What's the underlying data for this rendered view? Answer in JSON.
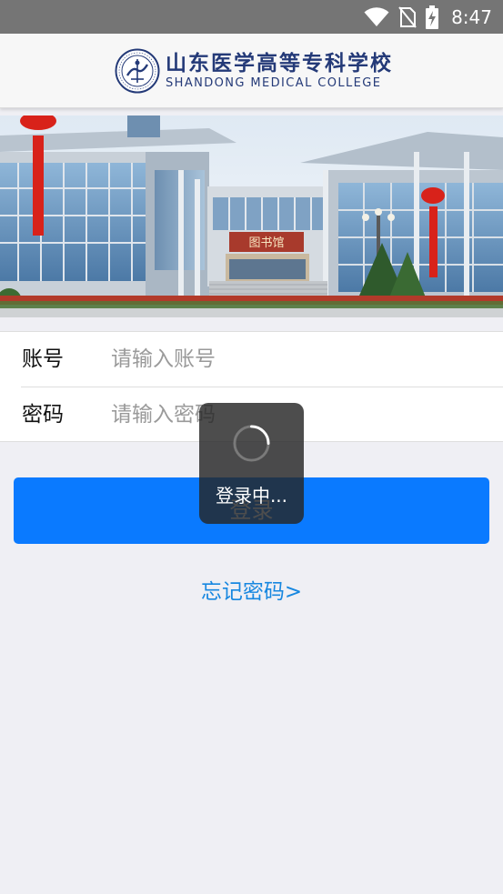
{
  "status_bar": {
    "time": "8:47",
    "icons": [
      "wifi-icon",
      "no-sim-icon",
      "battery-charging-icon"
    ]
  },
  "header": {
    "school_name_cn": "山东医学高等专科学校",
    "school_name_en": "SHANDONG MEDICAL COLLEGE",
    "logo": "school-seal-icon"
  },
  "banner": {
    "image": "campus-library-building",
    "sign_text": "图书馆"
  },
  "form": {
    "account": {
      "label": "账号",
      "placeholder": "请输入账号",
      "value": ""
    },
    "password": {
      "label": "密码",
      "placeholder": "请输入密码",
      "value": ""
    }
  },
  "login_button": {
    "label": "登录"
  },
  "forgot_link": {
    "label": "忘记密码>"
  },
  "loading_toast": {
    "text": "登录中..."
  },
  "colors": {
    "primary_button": "#0a7aff",
    "link": "#1787e0",
    "status_bar": "#757575",
    "page_bg": "#efeff4",
    "brand_navy": "#243a78"
  }
}
